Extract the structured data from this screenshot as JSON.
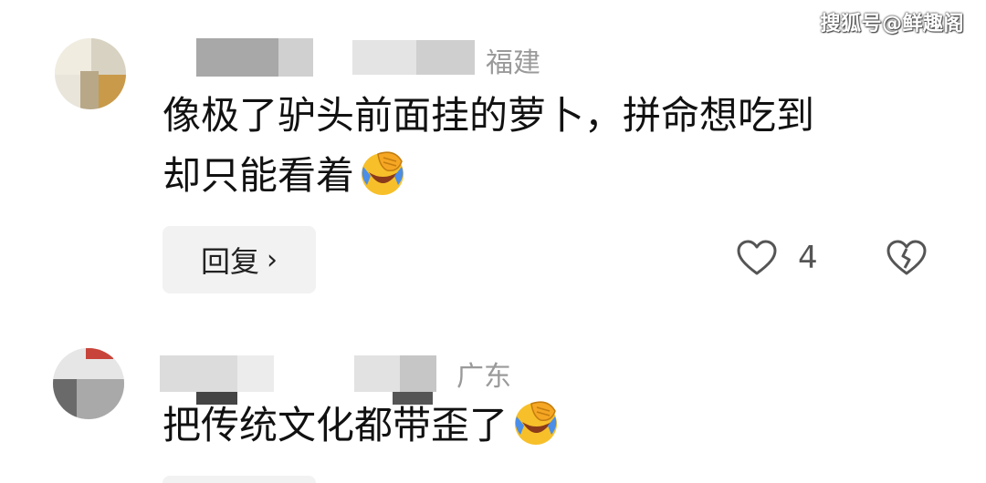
{
  "watermark": "搜狐号@鲜趣阁",
  "comments": [
    {
      "region": "福建",
      "text_line1": "像极了驴头前面挂的萝卜，拼命想吃到",
      "text_line2": "却只能看着",
      "emoji": "face-with-tears-of-joy-facepalm",
      "reply_label": "回复",
      "reply_chevron": "›",
      "like_count": "4",
      "icons": {
        "like": "heart-outline-icon",
        "dislike": "broken-heart-icon"
      }
    },
    {
      "region": "广东",
      "text_line1": "把传统文化都带歪了",
      "emoji": "face-with-tears-of-joy-facepalm"
    }
  ],
  "colors": {
    "text": "#111111",
    "meta": "#9a9a9a",
    "reply_bg": "#f2f2f2",
    "icon": "#555555",
    "emoji_yellow": "#f7c02a",
    "emoji_blue": "#4a8ee8"
  }
}
